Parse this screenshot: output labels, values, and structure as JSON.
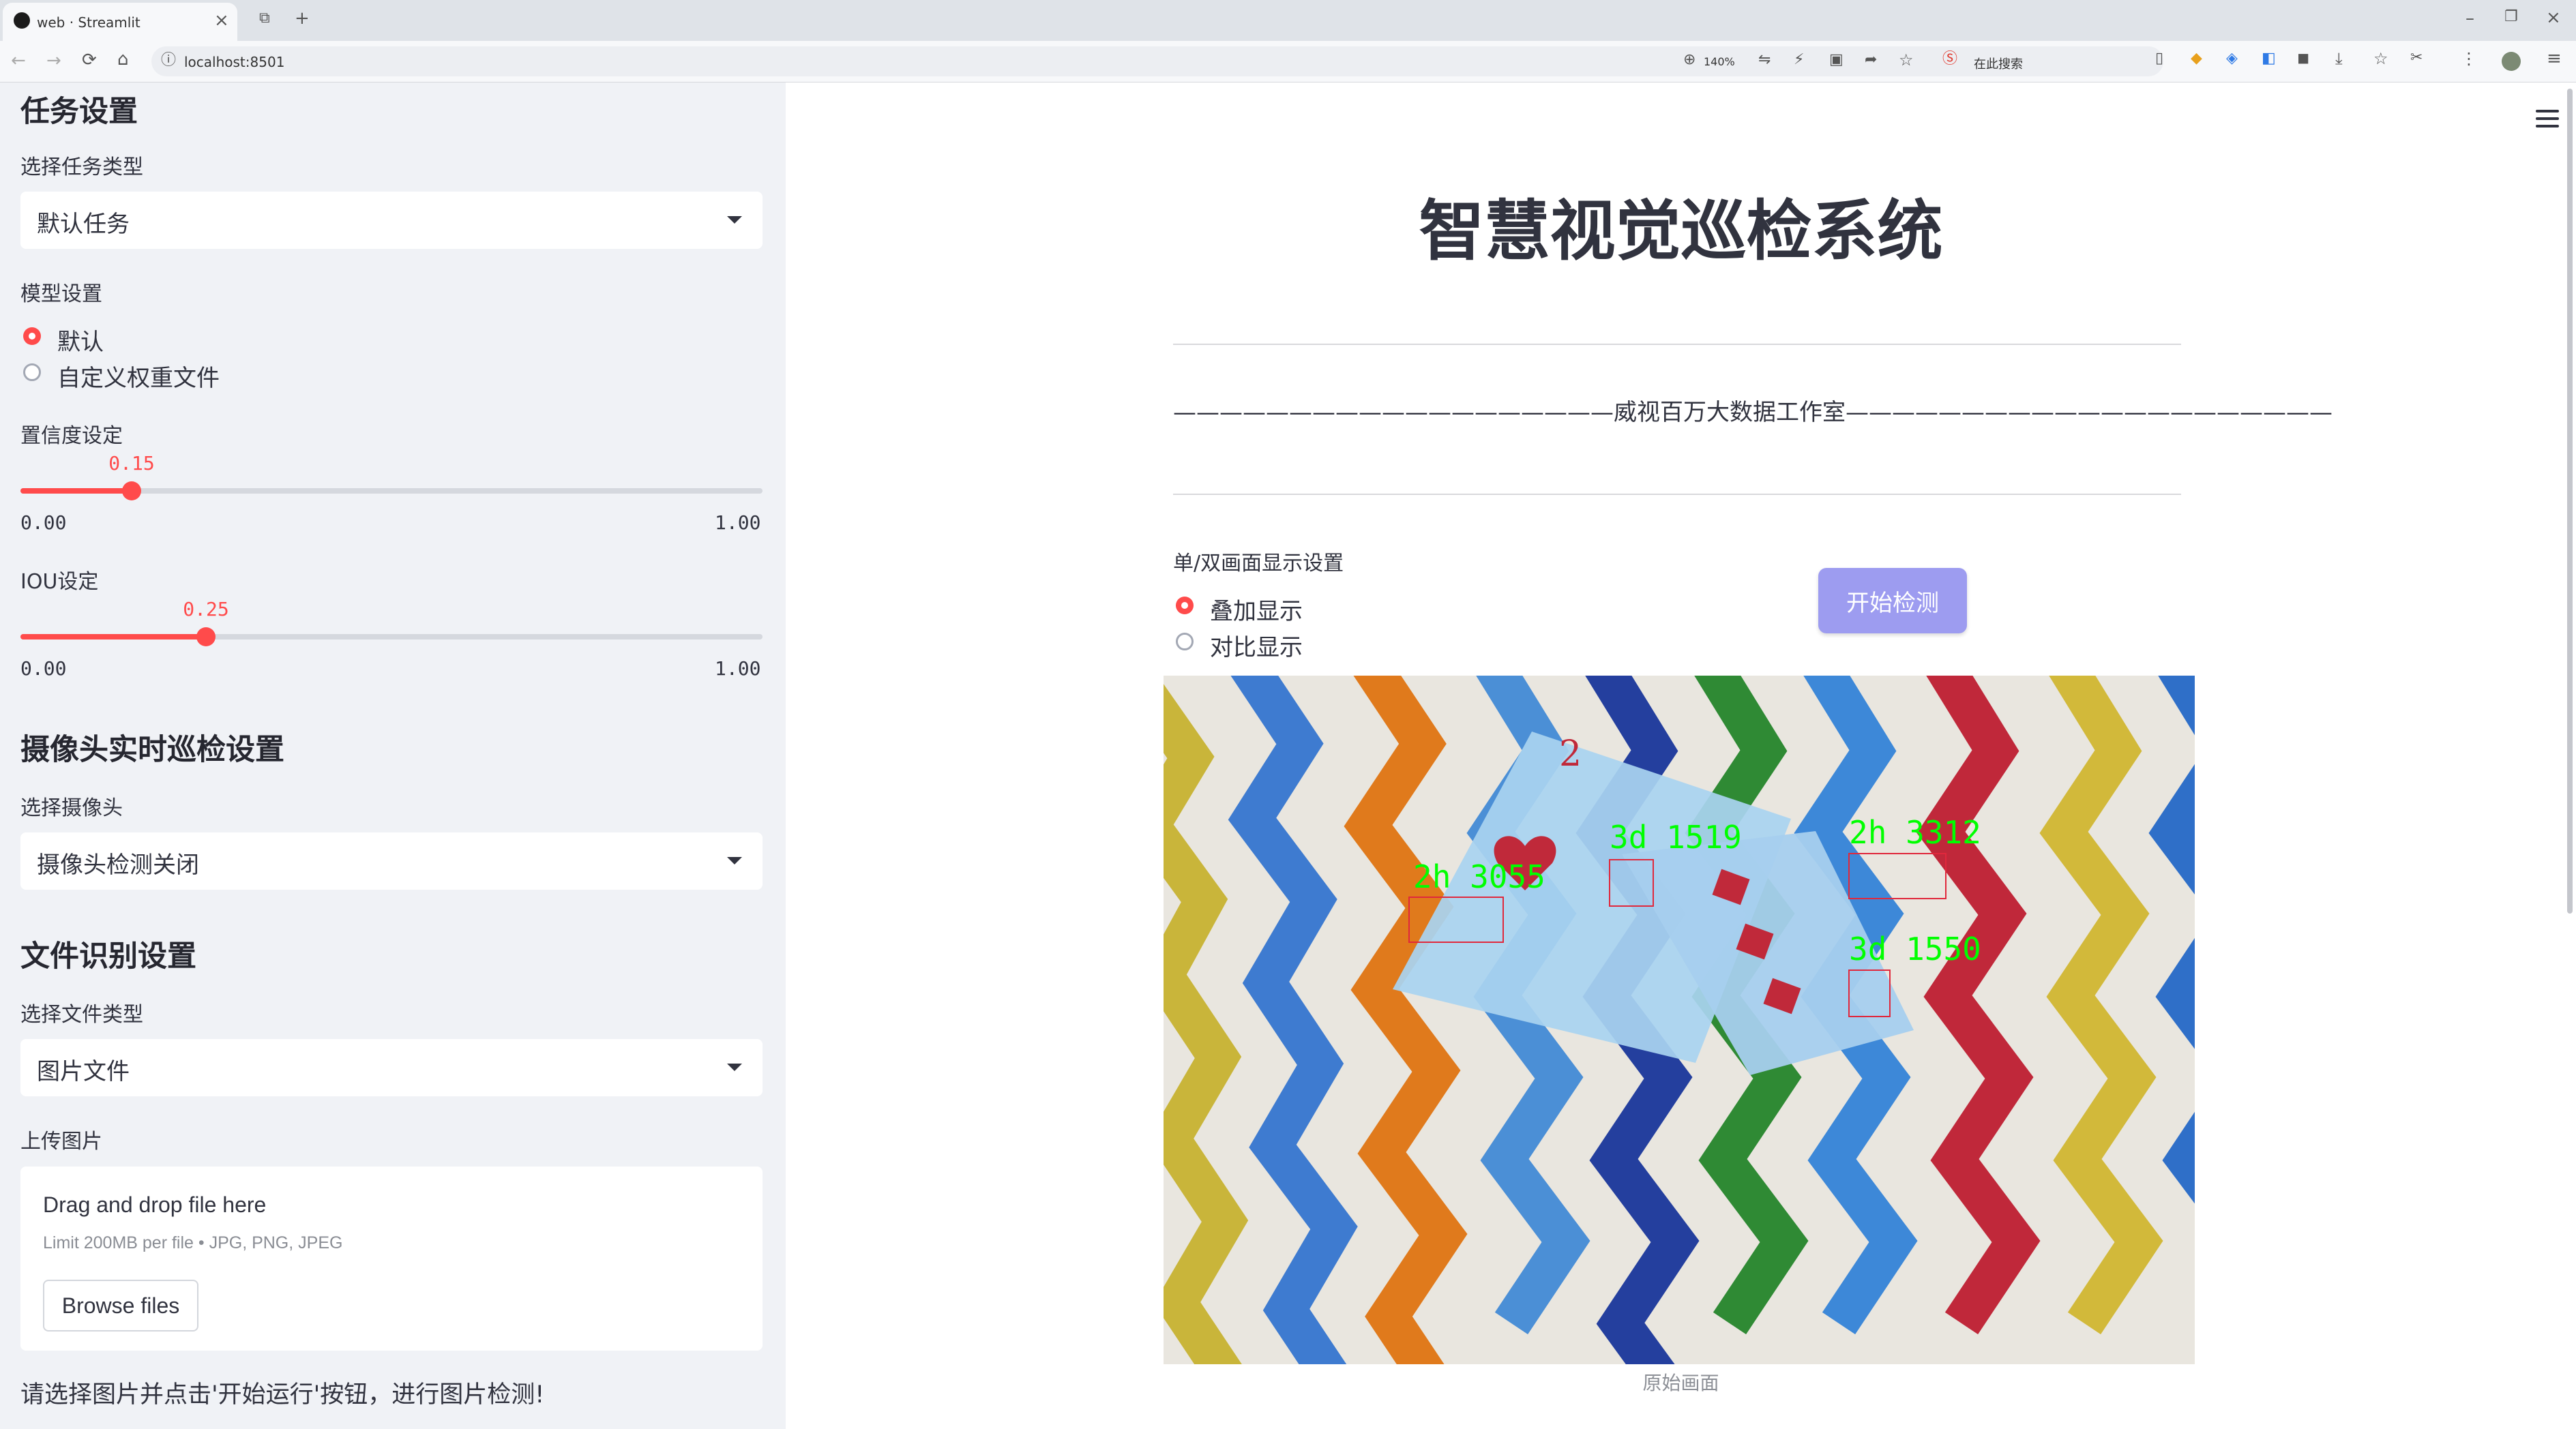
{
  "browser": {
    "tab_title": "web · Streamlit",
    "url": "localhost:8501",
    "zoom": "140%",
    "search_placeholder": "在此搜索"
  },
  "sidebar": {
    "task_heading": "任务设置",
    "task_type_label": "选择任务类型",
    "task_type_value": "默认任务",
    "model_label": "模型设置",
    "model_options": [
      "默认",
      "自定义权重文件"
    ],
    "model_selected": 0,
    "conf_label": "置信度设定",
    "conf_value": "0.15",
    "conf_fraction": 0.15,
    "conf_min": "0.00",
    "conf_max": "1.00",
    "iou_label": "IOU设定",
    "iou_value": "0.25",
    "iou_fraction": 0.25,
    "iou_min": "0.00",
    "iou_max": "1.00",
    "camera_heading": "摄像头实时巡检设置",
    "camera_label": "选择摄像头",
    "camera_value": "摄像头检测关闭",
    "file_heading": "文件识别设置",
    "file_type_label": "选择文件类型",
    "file_type_value": "图片文件",
    "upload_label": "上传图片",
    "drop_text": "Drag and drop file here",
    "limit_text": "Limit 200MB per file • JPG, PNG, JPEG",
    "browse_label": "Browse files",
    "hint": "请选择图片并点击'开始运行'按钮，进行图片检测!"
  },
  "main": {
    "title": "智慧视觉巡检系统",
    "subtitle": "———————————————————威视百万大数据工作室—————————————————————",
    "display_label": "单/双画面显示设置",
    "display_options": [
      "叠加显示",
      "对比显示"
    ],
    "display_selected": 0,
    "start_button": "开始检测",
    "caption": "原始画面",
    "detections": [
      {
        "label": "2h",
        "score": "3055"
      },
      {
        "label": "3d",
        "score": "1519"
      },
      {
        "label": "2h",
        "score": "3312"
      },
      {
        "label": "3d",
        "score": "1550"
      }
    ]
  },
  "colors": {
    "accent": "#ff4b4b",
    "sidebar_bg": "#f0f2f6",
    "button": "#9d9cf0",
    "detection": "#00ff00",
    "box": "#e0283c"
  }
}
